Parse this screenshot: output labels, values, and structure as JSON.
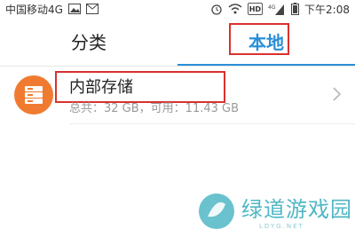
{
  "status_bar": {
    "carrier": "中国移动4G",
    "network_badge": "4G",
    "hd_label": "HD",
    "time": "下午2:08",
    "icons": [
      "image-icon",
      "mail-icon",
      "alarm-icon",
      "wifi-icon",
      "hd-icon",
      "signal-icon",
      "battery-icon"
    ]
  },
  "tabs": [
    {
      "label": "分类",
      "active": false
    },
    {
      "label": "本地",
      "active": true
    }
  ],
  "storage": {
    "title": "内部存储",
    "subtitle": "总共：32 GB，可用：11.43 GB",
    "icon": "storage-icon"
  },
  "watermark": {
    "main": "绿道游戏园",
    "sub": "LDYG.NET"
  },
  "colors": {
    "accent": "#2a8fd8",
    "storage_icon": "#f07b30",
    "highlight": "#d9312f",
    "watermark": "#4fb7c5"
  }
}
